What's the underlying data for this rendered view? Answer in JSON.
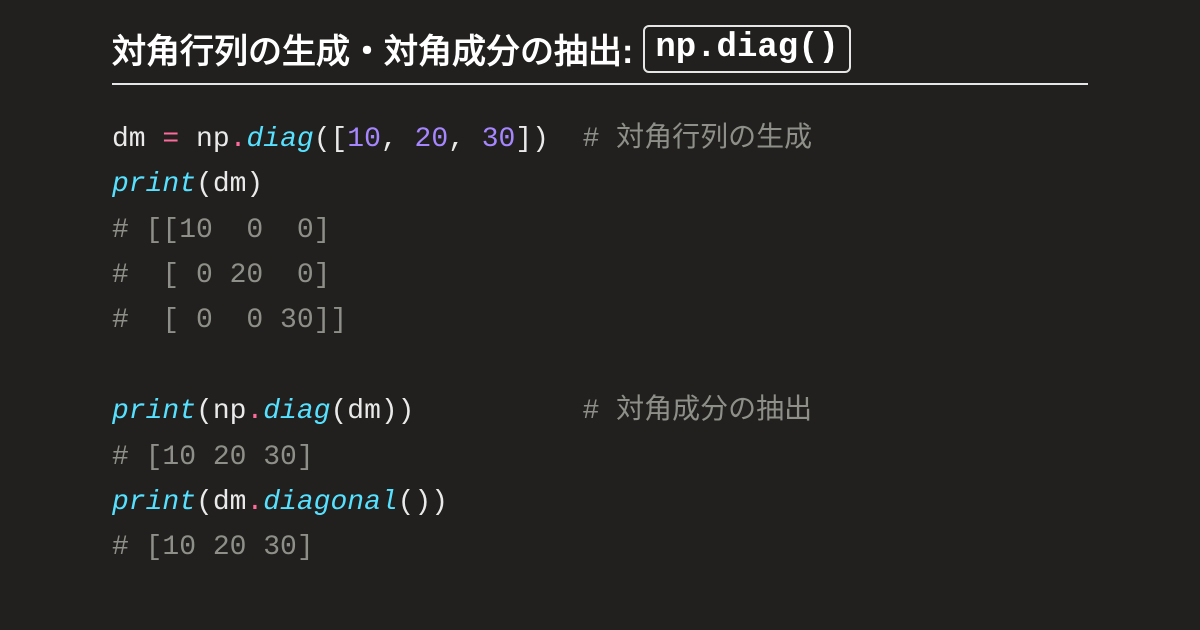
{
  "heading": {
    "title_text": "対角行列の生成・対角成分の抽出:",
    "badge_code": "np.diag()"
  },
  "code": {
    "tokens": [
      [
        {
          "t": "var",
          "v": "dm "
        },
        {
          "t": "op",
          "v": "="
        },
        {
          "t": "var",
          "v": " np"
        },
        {
          "t": "op",
          "v": "."
        },
        {
          "t": "func",
          "v": "diag"
        },
        {
          "t": "punct",
          "v": "(["
        },
        {
          "t": "num",
          "v": "10"
        },
        {
          "t": "punct",
          "v": ", "
        },
        {
          "t": "num",
          "v": "20"
        },
        {
          "t": "punct",
          "v": ", "
        },
        {
          "t": "num",
          "v": "30"
        },
        {
          "t": "punct",
          "v": "])  "
        },
        {
          "t": "comment",
          "v": "# 対角行列の生成"
        }
      ],
      [
        {
          "t": "func",
          "v": "print"
        },
        {
          "t": "punct",
          "v": "(dm)"
        }
      ],
      [
        {
          "t": "comment",
          "v": "# [[10  0  0]"
        }
      ],
      [
        {
          "t": "comment",
          "v": "#  [ 0 20  0]"
        }
      ],
      [
        {
          "t": "comment",
          "v": "#  [ 0  0 30]]"
        }
      ],
      [
        {
          "t": "var",
          "v": ""
        }
      ],
      [
        {
          "t": "func",
          "v": "print"
        },
        {
          "t": "punct",
          "v": "(np"
        },
        {
          "t": "op",
          "v": "."
        },
        {
          "t": "func",
          "v": "diag"
        },
        {
          "t": "punct",
          "v": "(dm))          "
        },
        {
          "t": "comment",
          "v": "# 対角成分の抽出"
        }
      ],
      [
        {
          "t": "comment",
          "v": "# [10 20 30]"
        }
      ],
      [
        {
          "t": "func",
          "v": "print"
        },
        {
          "t": "punct",
          "v": "(dm"
        },
        {
          "t": "op",
          "v": "."
        },
        {
          "t": "func",
          "v": "diagonal"
        },
        {
          "t": "punct",
          "v": "())"
        }
      ],
      [
        {
          "t": "comment",
          "v": "# [10 20 30]"
        }
      ]
    ]
  }
}
